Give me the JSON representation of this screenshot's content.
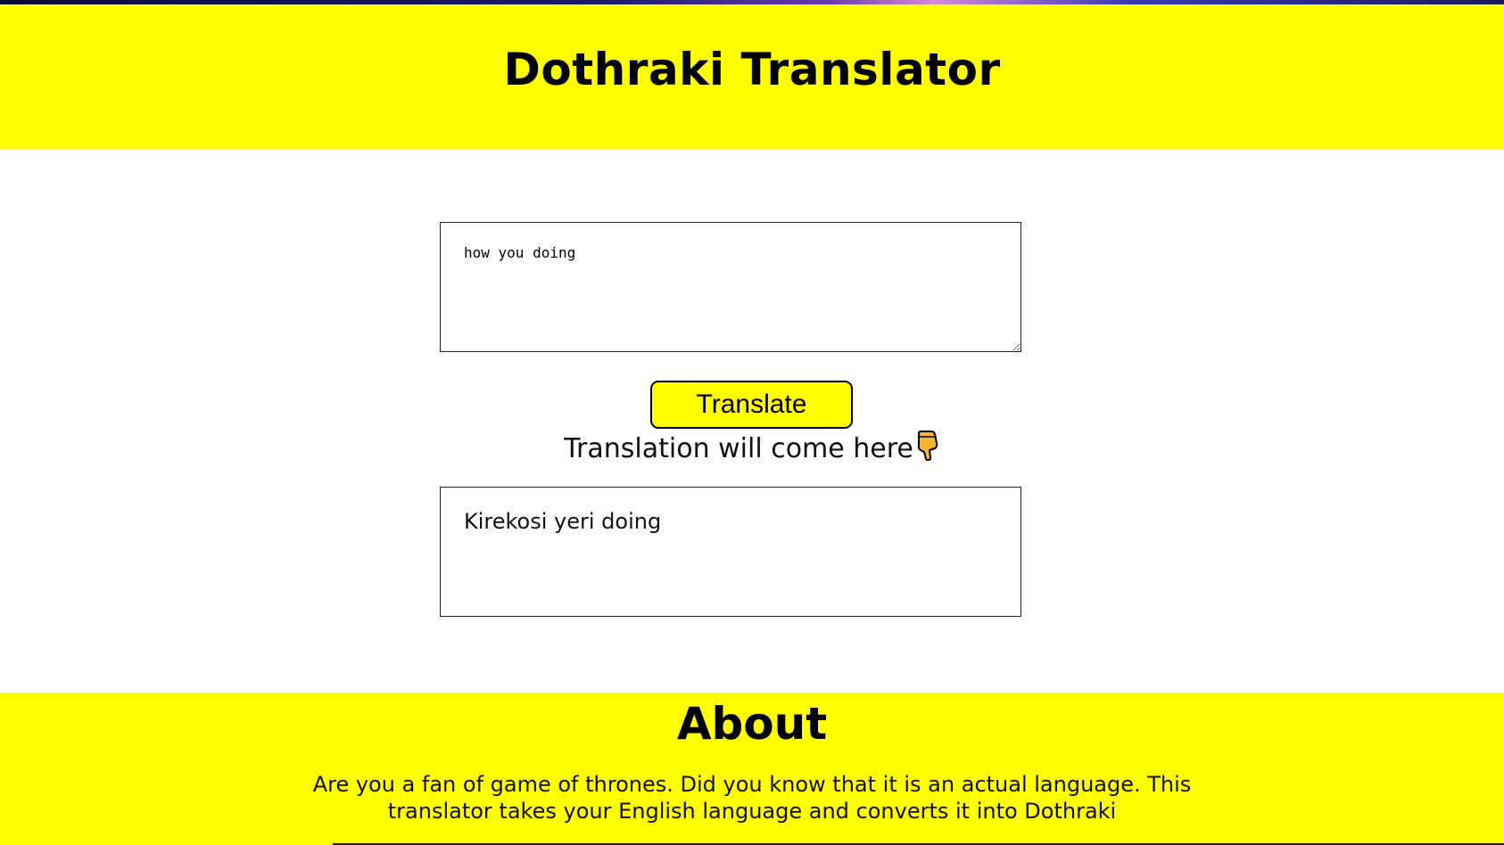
{
  "header": {
    "title": "Dothraki Translator"
  },
  "translator": {
    "input_value": "how you doing",
    "button_label": "Translate",
    "output_label": "Translation will come here",
    "output_value": "Kirekosi yeri doing"
  },
  "about": {
    "heading": "About",
    "body": "Are you a fan of game of thrones. Did you know that it is an actual language. This translator takes your English language and converts it into Dothraki"
  },
  "colors": {
    "accent": "#ffff00",
    "text": "#000000",
    "background": "#ffffff"
  },
  "icons": {
    "output_pointer": "pointing-down-hand-icon"
  }
}
